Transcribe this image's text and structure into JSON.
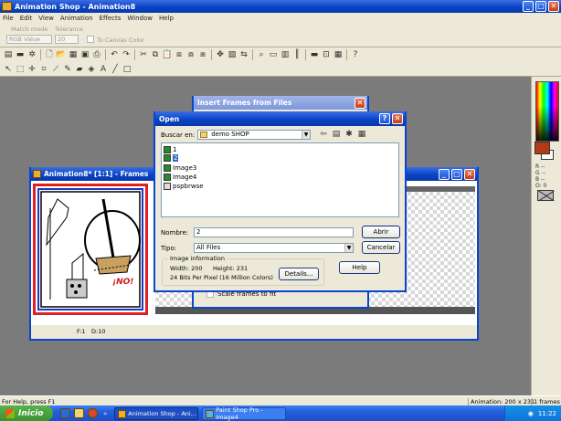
{
  "app": {
    "title": "Animation Shop - Animation8",
    "menu": [
      "File",
      "Edit",
      "View",
      "Animation",
      "Effects",
      "Window",
      "Help"
    ]
  },
  "options": {
    "match_mode_label": "Match mode",
    "match_mode_value": "RGB Value",
    "tolerance_label": "Tolerance",
    "tolerance_value": "20",
    "to_canvas_label": "To Canvas Color"
  },
  "frames_window": {
    "title": "Animation8* [1:1] - Frames",
    "frame_label": "F:1",
    "delay_label": "D:10",
    "sign_text": "¡NO!"
  },
  "insert_dialog": {
    "title": "Insert Frames from Files",
    "scale_label": "Scale frames to fit"
  },
  "open_dialog": {
    "title": "Open",
    "look_in_label": "Buscar en:",
    "look_in_value": "demo SHOP",
    "files": [
      {
        "name": "1",
        "icon": "image-file-icon"
      },
      {
        "name": "2",
        "icon": "image-file-icon",
        "selected": true
      },
      {
        "name": "Image3",
        "icon": "image-file-icon"
      },
      {
        "name": "Image4",
        "icon": "image-file-icon"
      },
      {
        "name": "pspbrwse",
        "icon": "browse-file-icon"
      }
    ],
    "filename_label": "Nombre:",
    "filename_value": "2",
    "type_label": "Tipo:",
    "type_value": "All Files",
    "open_button": "Abrir",
    "cancel_button": "Cancelar",
    "help_button": "Help",
    "details_button": "Details...",
    "info_title": "Image information",
    "width_text": "Width: 200",
    "height_text": "Height: 231",
    "bits_text": "24 Bits Per Pixel (16 Million Colors)"
  },
  "status": {
    "help": "For Help, press F1",
    "animation": "Animation: 200 x 231",
    "frames": "1 frames"
  },
  "taskbar": {
    "start": "Inicio",
    "tasks": [
      "Animation Shop - Ani...",
      "Paint Shop Pro - Image4"
    ],
    "time": "11:22"
  },
  "right_panel": {
    "rows": [
      "R --",
      "G --",
      "B --",
      "O: 0"
    ]
  },
  "colors": {
    "titlebar": "#0a44c8",
    "foreground_swatch": "#b23a17",
    "frame_border": "#e02020",
    "frame_inner_border": "#1a3ac0"
  }
}
